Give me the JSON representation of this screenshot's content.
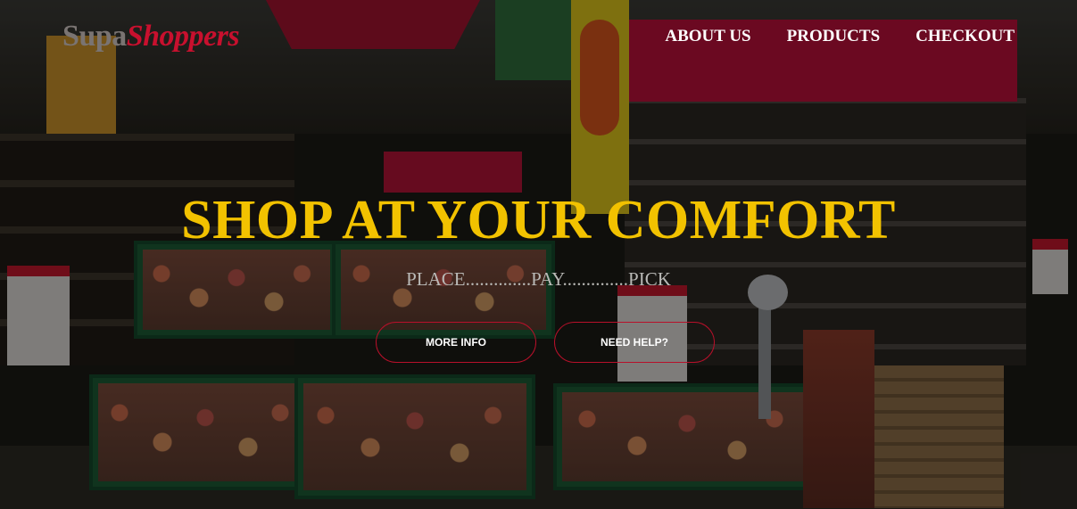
{
  "header": {
    "logo": {
      "part1": "Supa",
      "part2": "Shoppers"
    },
    "nav": [
      {
        "label": "ABOUT US"
      },
      {
        "label": "PRODUCTS"
      },
      {
        "label": "CHECKOUT"
      }
    ]
  },
  "hero": {
    "title": "SHOP AT YOUR COMFORT",
    "tagline": "PLACE..............PAY..............PICK",
    "buttons": {
      "more_info": "MORE INFO",
      "need_help": "NEED HELP?"
    }
  },
  "colors": {
    "logo_gray": "#7a7472",
    "logo_red": "#c8102e",
    "title_yellow": "#f2c200",
    "button_border": "#b8102a",
    "nav_text": "#ffffff"
  }
}
